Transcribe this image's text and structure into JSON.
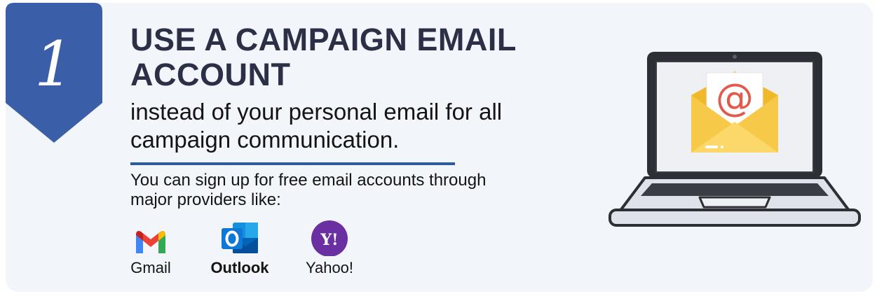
{
  "step": {
    "number": "1"
  },
  "headline": "USE A CAMPAIGN EMAIL ACCOUNT",
  "subhead": "instead of your personal email for all campaign communication.",
  "body_text": "You can sign up for free email accounts through major providers like:",
  "providers": [
    {
      "name": "Gmail",
      "icon": "gmail-icon"
    },
    {
      "name": "Outlook",
      "icon": "outlook-icon"
    },
    {
      "name": "Yahoo!",
      "icon": "yahoo-icon",
      "logo_text": "Y!"
    }
  ],
  "illustration": {
    "icon": "laptop-email-icon",
    "symbol": "@"
  },
  "colors": {
    "ribbon": "#3b5ea8",
    "headline": "#2b3047",
    "divider": "#2e5a9e",
    "background": "#f2f5fa",
    "yahoo": "#6a2fa0",
    "envelope": "#f7c948",
    "at_symbol": "#e05b4b"
  }
}
